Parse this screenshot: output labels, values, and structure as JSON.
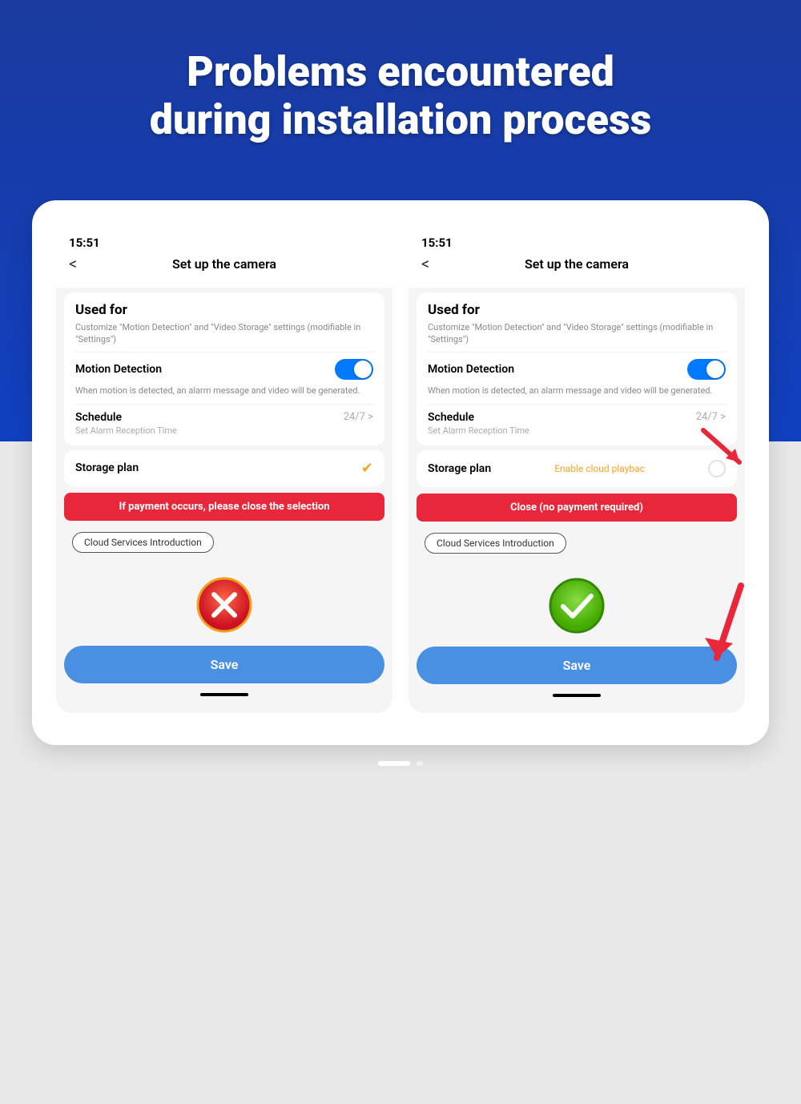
{
  "header": {
    "title": "Problems encountered\nduring installation process",
    "background_color": "#1040c0"
  },
  "phones": [
    {
      "id": "left-phone",
      "status_time": "15:51",
      "nav_back": "<",
      "nav_title": "Set up  the camera",
      "used_for_title": "Used for",
      "used_for_desc": "Customize \"Motion Detection\" and \"Video Storage\" settings (modifiable in \"Settings\")",
      "motion_detection_label": "Motion Detection",
      "motion_detection_on": true,
      "motion_desc": "When motion is detected, an alarm message and video will be generated.",
      "schedule_label": "Schedule",
      "schedule_value": "24/7 >",
      "alarm_label": "Set Alarm Reception Time",
      "storage_label": "Storage plan",
      "storage_status": "check",
      "banner_text": "If payment occurs, please close the selection",
      "cloud_intro_label": "Cloud Services Introduction",
      "status_icon": "error",
      "save_label": "Save"
    },
    {
      "id": "right-phone",
      "status_time": "15:51",
      "nav_back": "<",
      "nav_title": "Set up  the camera",
      "used_for_title": "Used for",
      "used_for_desc": "Customize \"Motion Detection\" and \"Video Storage\" settings (modifiable in \"Settings\")",
      "motion_detection_label": "Motion Detection",
      "motion_detection_on": true,
      "motion_desc": "When motion is detected, an alarm message and video will be generated.",
      "schedule_label": "Schedule",
      "schedule_value": "24/7 >",
      "alarm_label": "Set Alarm Reception Time",
      "storage_label": "Storage plan",
      "storage_status": "cloud",
      "storage_cloud_text": "Enable cloud playbac",
      "banner_text": "Close (no payment required)",
      "cloud_intro_label": "Cloud Services Introduction",
      "status_icon": "check",
      "save_label": "Save"
    }
  ],
  "bottom_indicator": {
    "dots": [
      "long",
      "small"
    ]
  }
}
